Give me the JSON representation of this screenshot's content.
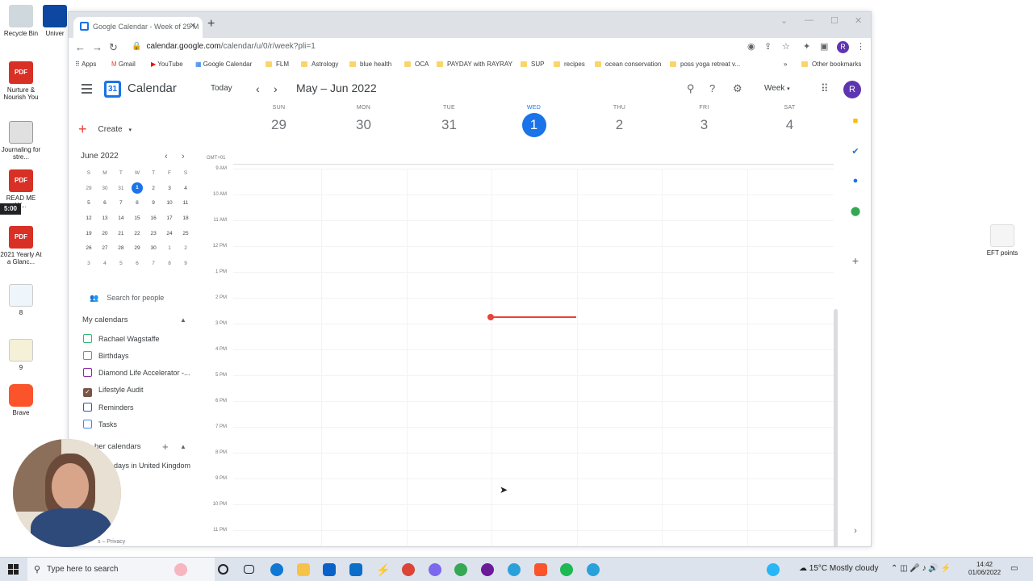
{
  "desktop": {
    "icons_left": [
      {
        "label": "Recycle Bin"
      },
      {
        "label": "Univer"
      },
      {
        "label": "Nurture & Nourish You"
      },
      {
        "label": "Journaling for stre..."
      },
      {
        "label": "READ ME W..."
      },
      {
        "label": "2021 Yearly At a Glanc..."
      },
      {
        "label": "8"
      },
      {
        "label": "9"
      },
      {
        "label": "Brave"
      }
    ],
    "icon_right": {
      "label": "EFT points"
    },
    "pdf_badge": "PDF",
    "clock_overlay": "5:00"
  },
  "browser": {
    "tab_title": "Google Calendar - Week of 29 M",
    "url_host": "calendar.google.com",
    "url_path": "/calendar/u/0/r/week?pli=1",
    "profile_initial": "R",
    "bookmarks": [
      "Apps",
      "Gmail",
      "YouTube",
      "Google Calendar",
      "FLM",
      "Astrology",
      "blue health",
      "OCA",
      "PAYDAY with RAYRAY",
      "SUP",
      "recipes",
      "ocean conservation",
      "poss yoga retreat v..."
    ],
    "other_bookmarks": "Other bookmarks"
  },
  "calendar": {
    "app_name": "Calendar",
    "logo_day": "31",
    "today_label": "Today",
    "range_label": "May – Jun 2022",
    "view_label": "Week",
    "avatar_initial": "R",
    "create_label": "Create",
    "mini": {
      "month": "June 2022",
      "dow": [
        "S",
        "M",
        "T",
        "W",
        "T",
        "F",
        "S"
      ],
      "weeks": [
        [
          "29",
          "30",
          "31",
          "1",
          "2",
          "3",
          "4"
        ],
        [
          "5",
          "6",
          "7",
          "8",
          "9",
          "10",
          "11"
        ],
        [
          "12",
          "13",
          "14",
          "15",
          "16",
          "17",
          "18"
        ],
        [
          "19",
          "20",
          "21",
          "22",
          "23",
          "24",
          "25"
        ],
        [
          "26",
          "27",
          "28",
          "29",
          "30",
          "1",
          "2"
        ],
        [
          "3",
          "4",
          "5",
          "6",
          "7",
          "8",
          "9"
        ]
      ]
    },
    "search_people": "Search for people",
    "my_calendars_title": "My calendars",
    "my_calendars": [
      {
        "name": "Rachael Wagstaffe",
        "color": "#33b679",
        "checked": false
      },
      {
        "name": "Birthdays",
        "color": "#33b679",
        "checked": false
      },
      {
        "name": "Diamond Life Accelerator -...",
        "color": "#8e24aa",
        "checked": false
      },
      {
        "name": "Lifestyle Audit",
        "color": "#795548",
        "checked": true
      },
      {
        "name": "Reminders",
        "color": "#3f51b5",
        "checked": false
      },
      {
        "name": "Tasks",
        "color": "#4285f4",
        "checked": false
      }
    ],
    "other_calendars_title": "her calendars",
    "other_calendars": [
      "days in United Kingdom"
    ],
    "terms": "s – Privacy",
    "timezone": "GMT+01",
    "days": [
      {
        "dow": "SUN",
        "date": "29"
      },
      {
        "dow": "MON",
        "date": "30"
      },
      {
        "dow": "TUE",
        "date": "31"
      },
      {
        "dow": "WED",
        "date": "1"
      },
      {
        "dow": "THU",
        "date": "2"
      },
      {
        "dow": "FRI",
        "date": "3"
      },
      {
        "dow": "SAT",
        "date": "4"
      }
    ],
    "hours": [
      "9 AM",
      "10 AM",
      "11 AM",
      "12 PM",
      "1 PM",
      "2 PM",
      "3 PM",
      "4 PM",
      "5 PM",
      "6 PM",
      "7 PM",
      "8 PM",
      "9 PM",
      "10 PM",
      "11 PM"
    ]
  },
  "taskbar": {
    "search_placeholder": "Type here to search",
    "weather": "15°C  Mostly cloudy",
    "time": "14:42",
    "date": "01/06/2022"
  },
  "colors": {
    "accent": "#1a73e8",
    "now_line": "#ea4335"
  }
}
